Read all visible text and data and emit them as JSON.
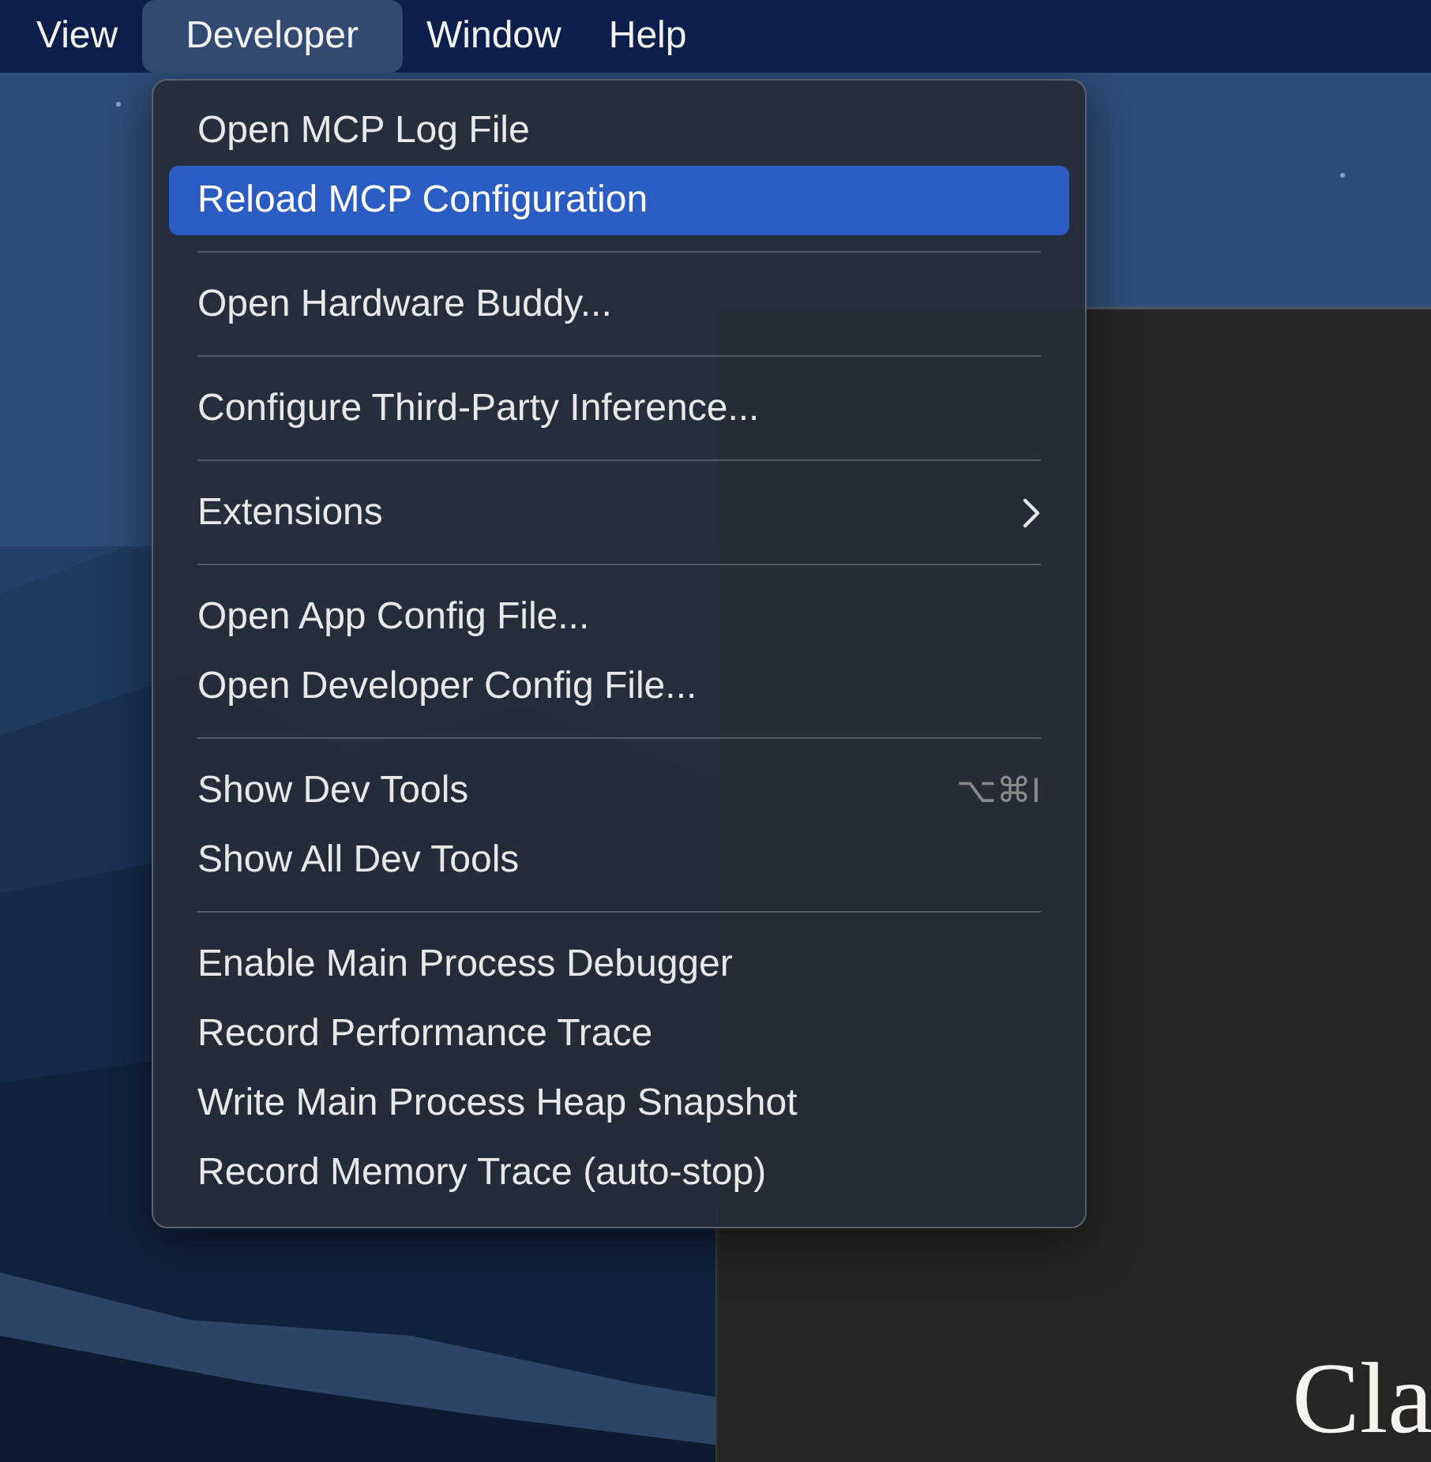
{
  "menubar": {
    "items": [
      {
        "label": "View",
        "selected": false
      },
      {
        "label": "Developer",
        "selected": true
      },
      {
        "label": "Window",
        "selected": false
      },
      {
        "label": "Help",
        "selected": false
      }
    ]
  },
  "app_window": {
    "title_fragment": "Cla"
  },
  "menu": {
    "groups": [
      [
        {
          "label": "Open MCP Log File",
          "selected": false,
          "submenu": false
        },
        {
          "label": "Reload MCP Configuration",
          "selected": true,
          "submenu": false
        }
      ],
      [
        {
          "label": "Open Hardware Buddy...",
          "selected": false,
          "submenu": false
        }
      ],
      [
        {
          "label": "Configure Third-Party Inference...",
          "selected": false,
          "submenu": false
        }
      ],
      [
        {
          "label": "Extensions",
          "selected": false,
          "submenu": true
        }
      ],
      [
        {
          "label": "Open App Config File...",
          "selected": false,
          "submenu": false
        },
        {
          "label": "Open Developer Config File...",
          "selected": false,
          "submenu": false
        }
      ],
      [
        {
          "label": "Show Dev Tools",
          "selected": false,
          "submenu": false,
          "shortcut": "⌥⌘I"
        },
        {
          "label": "Show All Dev Tools",
          "selected": false,
          "submenu": false
        }
      ],
      [
        {
          "label": "Enable Main Process Debugger",
          "selected": false,
          "submenu": false
        },
        {
          "label": "Record Performance Trace",
          "selected": false,
          "submenu": false
        },
        {
          "label": "Write Main Process Heap Snapshot",
          "selected": false,
          "submenu": false
        },
        {
          "label": "Record Memory Trace (auto-stop)",
          "selected": false,
          "submenu": false
        }
      ]
    ]
  }
}
